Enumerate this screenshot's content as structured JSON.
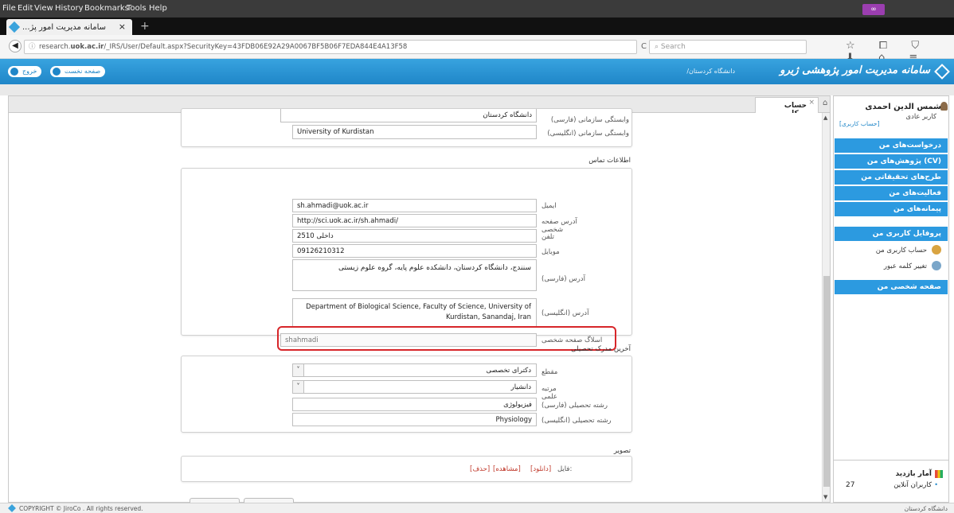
{
  "browser": {
    "menu": [
      "File",
      "Edit",
      "View",
      "History",
      "Bookmarks",
      "Tools",
      "Help"
    ],
    "tab_title": "...سامانه مدیریت امور پژ",
    "tab_close": "×",
    "new_tab": "+",
    "badge": "∞",
    "url_prefix": "research.",
    "url_domain": "uok.ac.ir",
    "url_rest": "/_IRS/User/Default.aspx?SecurityKey=43FDB06E92A29A0067BF5B06F7EDA844E4A13F58",
    "reload": "C",
    "search_placeholder": "Search",
    "toolbar_icons": "☆ ⧠ ⛉ ⬇ ⌂ ≡"
  },
  "header": {
    "title": "سامانه مدیریت امور پژوهشی ژیرو",
    "subtitle": "/دانشگاه کردستان",
    "btn_exit": "خروج",
    "btn_home": "صفحه نخست"
  },
  "content_tab": {
    "label": "حساب کاربر...",
    "close": "×",
    "home": "⌂"
  },
  "form": {
    "org_fa_label": "وابستگی سازمانی (فارسی)",
    "org_fa_value": "دانشگاه کردستان",
    "org_en_label": "وابستگی سازمانی (انگلیسی)",
    "org_en_value": "University of Kurdistan",
    "contact_head": "اطلاعات تماس",
    "email_label": "ایمیل",
    "email_value": "sh.ahmadi@uok.ac.ir",
    "homepage_label": "آدرس صفحه شخصی",
    "homepage_value": "http://sci.uok.ac.ir/sh.ahmadi/",
    "phone_label": "تلفن",
    "phone_value": "داخلی 2510",
    "mobile_label": "موبایل",
    "mobile_value": "09126210312",
    "addr_fa_label": "آدرس (فارسی)",
    "addr_fa_value": "سنندج، دانشگاه کردستان، دانشکده علوم پایه، گروه علوم زیستی",
    "addr_en_label": "آدرس (انگلیسی)",
    "addr_en_line1": "Department of Biological Science, Faculty of Science, University of",
    "addr_en_line2": "Kurdistan, Sanandaj, Iran",
    "slug_label": "اسلاگ صفحه شخصی",
    "slug_value": "shahmadi",
    "degree_head": "آخرین مدرک تحصیلی",
    "level_label": "مقطع",
    "level_value": "دکترای تخصصی",
    "rank_label": "مرتبه علمی",
    "rank_value": "دانشیار",
    "field_fa_label": "رشته تحصیلی (فارسی)",
    "field_fa_value": "فیزیولوژی",
    "field_en_label": "رشته تحصیلی (انگلیسی)",
    "field_en_value": "Physiology",
    "image_head": "تصویر",
    "file_label": "فایل:",
    "file_download": "[دانلود]",
    "file_view": "[مشاهده]",
    "file_delete": "[حذف]"
  },
  "sidebar": {
    "user_name": "شمس الدین احمدی",
    "user_role": "کاربر عادی",
    "user_link": "[حساب کاربری]",
    "menu": [
      "درخواست‌های من",
      "پژوهش‌های من (CV)",
      "طرح‌های تحقیقاتی من",
      "فعالیت‌های من",
      "پیمانه‌های من",
      "پروفایل کاربری من"
    ],
    "sub": [
      "حساب کاربری من",
      "تغییر کلمه عبور"
    ],
    "personal_page": "صفحه شخصی من",
    "stats_title": "آمار بازدید",
    "stats_online_label": "کاربران آنلاین",
    "stats_online_value": "27"
  },
  "footer": {
    "copyright": "COPYRIGHT © JiroCo . All rights reserved.",
    "university": "دانشگاه کردستان"
  },
  "colors": {
    "accent": "#2c9ae0",
    "highlight": "#d7262a"
  }
}
